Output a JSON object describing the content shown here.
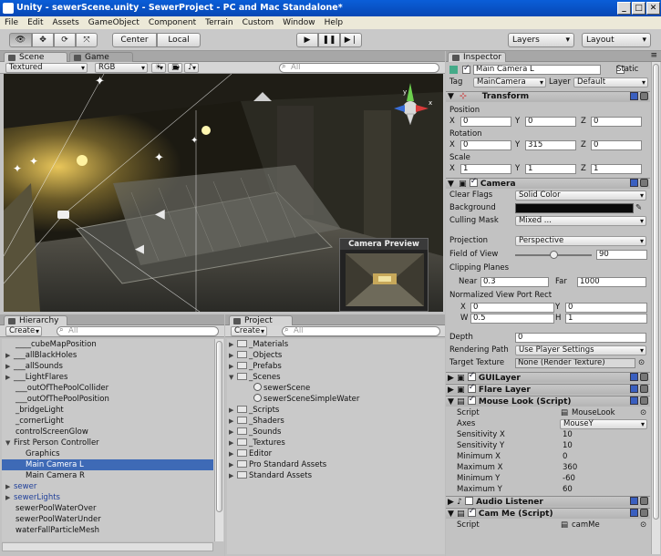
{
  "window": {
    "title": "Unity - sewerScene.unity - SewerProject - PC and Mac Standalone*"
  },
  "menu": [
    "File",
    "Edit",
    "Assets",
    "GameObject",
    "Component",
    "Terrain",
    "Custom",
    "Window",
    "Help"
  ],
  "toolbar": {
    "center_label": "Center",
    "local_label": "Local",
    "layers_label": "Layers",
    "layout_label": "Layout"
  },
  "scene": {
    "tab_scene": "Scene",
    "tab_game": "Game",
    "render_mode": "Textured",
    "color_mode": "RGB",
    "search_placeholder": "All",
    "camera_preview_title": "Camera Preview"
  },
  "hierarchy": {
    "tab": "Hierarchy",
    "create_label": "Create",
    "search_placeholder": "All",
    "items": [
      {
        "label": "____cubeMapPosition",
        "indent": 1,
        "arrow": "",
        "style": ""
      },
      {
        "label": "___allBlackHoles",
        "indent": 0,
        "arrow": "▶",
        "style": ""
      },
      {
        "label": "___allSounds",
        "indent": 0,
        "arrow": "▶",
        "style": ""
      },
      {
        "label": "___LightFlares",
        "indent": 0,
        "arrow": "▶",
        "style": ""
      },
      {
        "label": "___outOfThePoolCollider",
        "indent": 1,
        "arrow": "",
        "style": ""
      },
      {
        "label": "___outOfThePoolPosition",
        "indent": 1,
        "arrow": "",
        "style": ""
      },
      {
        "label": "_bridgeLight",
        "indent": 1,
        "arrow": "",
        "style": ""
      },
      {
        "label": "_cornerLight",
        "indent": 1,
        "arrow": "",
        "style": ""
      },
      {
        "label": "controlScreenGlow",
        "indent": 1,
        "arrow": "",
        "style": ""
      },
      {
        "label": "First Person Controller",
        "indent": 0,
        "arrow": "▼",
        "style": ""
      },
      {
        "label": "Graphics",
        "indent": 2,
        "arrow": "",
        "style": ""
      },
      {
        "label": "Main Camera L",
        "indent": 2,
        "arrow": "",
        "style": "sel"
      },
      {
        "label": "Main Camera R",
        "indent": 2,
        "arrow": "",
        "style": ""
      },
      {
        "label": "sewer",
        "indent": 0,
        "arrow": "▶",
        "style": "blue"
      },
      {
        "label": "sewerLights",
        "indent": 0,
        "arrow": "▶",
        "style": "blue"
      },
      {
        "label": "sewerPoolWaterOver",
        "indent": 1,
        "arrow": "",
        "style": ""
      },
      {
        "label": "sewerPoolWaterUnder",
        "indent": 1,
        "arrow": "",
        "style": ""
      },
      {
        "label": "waterFallParticleMesh",
        "indent": 1,
        "arrow": "",
        "style": ""
      }
    ]
  },
  "project": {
    "tab": "Project",
    "create_label": "Create",
    "search_placeholder": "All",
    "items": [
      {
        "label": "_Materials",
        "indent": 0,
        "arrow": "▶",
        "kind": "folder"
      },
      {
        "label": "_Objects",
        "indent": 0,
        "arrow": "▶",
        "kind": "folder"
      },
      {
        "label": "_Prefabs",
        "indent": 0,
        "arrow": "▶",
        "kind": "folder"
      },
      {
        "label": "_Scenes",
        "indent": 0,
        "arrow": "▼",
        "kind": "folder"
      },
      {
        "label": "sewerScene",
        "indent": 1,
        "arrow": "",
        "kind": "scene"
      },
      {
        "label": "sewerSceneSimpleWater",
        "indent": 1,
        "arrow": "",
        "kind": "scene"
      },
      {
        "label": "_Scripts",
        "indent": 0,
        "arrow": "▶",
        "kind": "folder"
      },
      {
        "label": "_Shaders",
        "indent": 0,
        "arrow": "▶",
        "kind": "folder"
      },
      {
        "label": "_Sounds",
        "indent": 0,
        "arrow": "▶",
        "kind": "folder"
      },
      {
        "label": "_Textures",
        "indent": 0,
        "arrow": "▶",
        "kind": "folder"
      },
      {
        "label": "Editor",
        "indent": 0,
        "arrow": "▶",
        "kind": "folder"
      },
      {
        "label": "Pro Standard Assets",
        "indent": 0,
        "arrow": "▶",
        "kind": "folder"
      },
      {
        "label": "Standard Assets",
        "indent": 0,
        "arrow": "▶",
        "kind": "folder"
      }
    ]
  },
  "inspector": {
    "tab": "Inspector",
    "object_name": "Main Camera L",
    "static_label": "Static",
    "tag_label": "Tag",
    "tag_value": "MainCamera",
    "layer_label": "Layer",
    "layer_value": "Default",
    "transform": {
      "title": "Transform",
      "position_label": "Position",
      "rotation_label": "Rotation",
      "scale_label": "Scale",
      "position": {
        "x": "0",
        "y": "0",
        "z": "0"
      },
      "rotation": {
        "x": "0",
        "y": "315",
        "z": "0"
      },
      "scale": {
        "x": "1",
        "y": "1",
        "z": "1"
      }
    },
    "camera": {
      "title": "Camera",
      "clear_flags_label": "Clear Flags",
      "clear_flags": "Solid Color",
      "background_label": "Background",
      "background_color": "#0a0a0a",
      "culling_mask_label": "Culling Mask",
      "culling_mask": "Mixed ...",
      "projection_label": "Projection",
      "projection": "Perspective",
      "fov_label": "Field of View",
      "fov": "90",
      "fov_fraction": 0.5,
      "clipping_label": "Clipping Planes",
      "near_label": "Near",
      "near": "0.3",
      "far_label": "Far",
      "far": "1000",
      "viewport_label": "Normalized View Port Rect",
      "vp_x": "0",
      "vp_y": "0",
      "vp_w": "0.5",
      "vp_h": "1",
      "depth_label": "Depth",
      "depth": "0",
      "rendering_path_label": "Rendering Path",
      "rendering_path": "Use Player Settings",
      "target_texture_label": "Target Texture",
      "target_texture": "None (Render Texture)"
    },
    "guilayer": {
      "title": "GUILayer"
    },
    "flarelayer": {
      "title": "Flare Layer"
    },
    "mouselook": {
      "title": "Mouse Look (Script)",
      "script_label": "Script",
      "script": "MouseLook",
      "axes_label": "Axes",
      "axes": "MouseY",
      "sens_x_label": "Sensitivity X",
      "sens_x": "10",
      "sens_y_label": "Sensitivity Y",
      "sens_y": "10",
      "min_x_label": "Minimum X",
      "min_x": "0",
      "max_x_label": "Maximum X",
      "max_x": "360",
      "min_y_label": "Minimum Y",
      "min_y": "-60",
      "max_y_label": "Maximum Y",
      "max_y": "60"
    },
    "audiolistener": {
      "title": "Audio Listener"
    },
    "camme": {
      "title": "Cam Me (Script)",
      "script_label": "Script",
      "script": "camMe"
    }
  },
  "colors": {
    "selection": "#3e6ab6",
    "titlebar": "#0747b4",
    "panel": "#c2c2c2"
  }
}
